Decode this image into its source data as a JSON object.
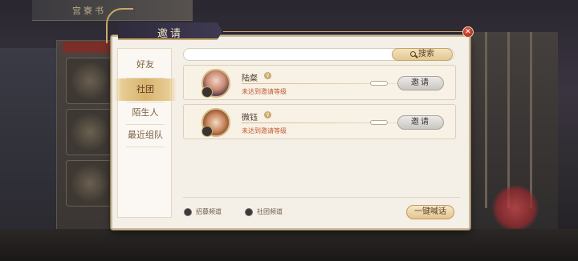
{
  "background": {
    "top_text": "宫寮书"
  },
  "dialog": {
    "title": "邀请",
    "close_glyph": "✕"
  },
  "side_nav": {
    "items": [
      {
        "label": "好友"
      },
      {
        "label": "社团"
      },
      {
        "label": "陌生人"
      },
      {
        "label": "最近组队"
      }
    ],
    "active_index": 1
  },
  "search": {
    "placeholder": "",
    "button_label": "搜索"
  },
  "members": [
    {
      "name": "陆粲",
      "status": "未达到邀请等级",
      "invite_label": "邀请"
    },
    {
      "name": "微钰",
      "status": "未达到邀请等级",
      "invite_label": "邀请"
    }
  ],
  "footer": {
    "channel_a": "招募频道",
    "channel_b": "社团频道",
    "one_key_label": "一键喊话"
  },
  "colors": {
    "accent_gold": "#c9a86c",
    "title_bar": "#2f2b3d",
    "hint_text": "#c4582f",
    "close_red": "#c23a2c"
  }
}
